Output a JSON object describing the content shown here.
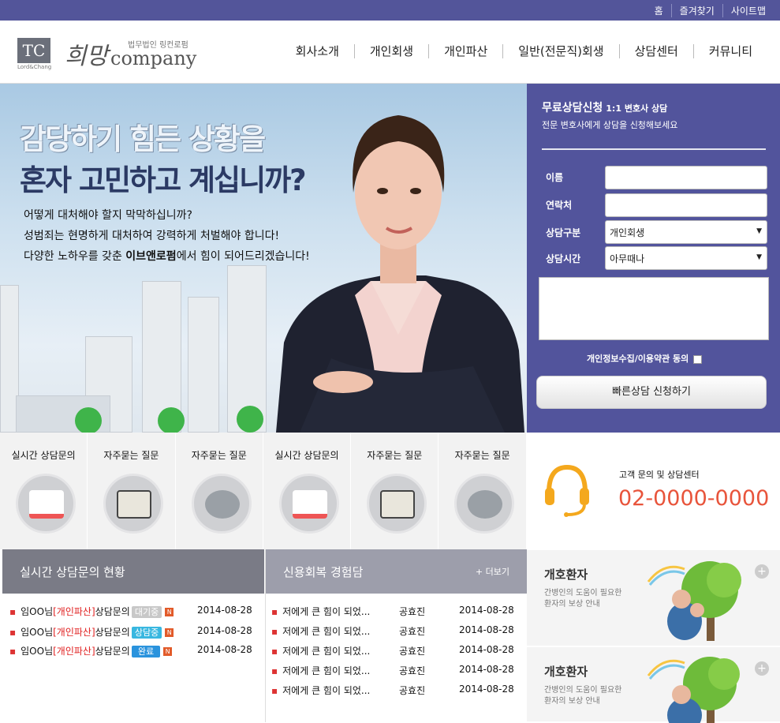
{
  "topbar": {
    "links": [
      "홈",
      "즐겨찾기",
      "사이트맵"
    ]
  },
  "logo": {
    "mark": "TC",
    "mark_caption": "Lord&Chang",
    "script": "희망",
    "sub": "법무법인 링컨로펌",
    "company": "company"
  },
  "nav": [
    "회사소개",
    "개인회생",
    "개인파산",
    "일반(전문직)회생",
    "상담센터",
    "커뮤니티"
  ],
  "hero": {
    "headline1": "감당하기 힘든 상황을",
    "headline2": "혼자 고민하고 계십니까?",
    "line1": "어떻게 대처해야 할지 막막하십니까?",
    "line2": "성범죄는 현명하게 대처하여 강력하게 처벌해야 합니다!",
    "line3_pre": "다양한 노하우를 갖춘 ",
    "line3_bold": "이브앤로펌",
    "line3_post": "에서 힘이 되어드리겠습니다!"
  },
  "form": {
    "title": "무료상담신청",
    "title_small": "1:1 변호사 상담",
    "subtitle": "전문 변호사에게 상담을 신청해보세요",
    "name_label": "이름",
    "phone_label": "연락처",
    "type_label": "상담구분",
    "type_value": "개인회생",
    "time_label": "상담시간",
    "time_value": "아무때나",
    "agree": "개인정보수집/이용약관 동의",
    "submit": "빠른상담 신청하기"
  },
  "quick": [
    {
      "label": "실시간 상담문의",
      "icon": "laptop-icon"
    },
    {
      "label": "자주묻는 질문",
      "icon": "glasses-icon"
    },
    {
      "label": "자주묻는 질문",
      "icon": "globe-dollar-icon"
    },
    {
      "label": "실시간 상담문의",
      "icon": "laptop-icon"
    },
    {
      "label": "자주묻는 질문",
      "icon": "glasses-icon"
    },
    {
      "label": "자주묻는 질문",
      "icon": "globe-dollar-icon"
    }
  ],
  "call": {
    "label": "고객 문의 및 상담센터",
    "phone": "02-0000-0000"
  },
  "consult": {
    "title": "실시간 상담문의 현황",
    "rows": [
      {
        "name": "임OO님",
        "tag": "[개인파산]",
        "text": "상담문의",
        "status": "대기중",
        "status_color": "#c8c8c8",
        "new": "N",
        "date": "2014-08-28"
      },
      {
        "name": "임OO님",
        "tag": "[개인파산]",
        "text": "상담문의",
        "status": "상담중",
        "status_color": "#38b7e0",
        "new": "N",
        "date": "2014-08-28"
      },
      {
        "name": "임OO님",
        "tag": "[개인파산]",
        "text": "상담문의",
        "status": "완료",
        "status_color": "#2a93dd",
        "new": "N",
        "date": "2014-08-28"
      }
    ]
  },
  "reviews": {
    "title": "신용회복 경험담",
    "more": "+ 더보기",
    "rows": [
      {
        "text": "저에게 큰 힘이 되었...",
        "author": "공효진",
        "date": "2014-08-28"
      },
      {
        "text": "저에게 큰 힘이 되었...",
        "author": "공효진",
        "date": "2014-08-28"
      },
      {
        "text": "저에게 큰 힘이 되었...",
        "author": "공효진",
        "date": "2014-08-28"
      },
      {
        "text": "저에게 큰 힘이 되었...",
        "author": "공효진",
        "date": "2014-08-28"
      },
      {
        "text": "저에게 큰 힘이 되었...",
        "author": "공효진",
        "date": "2014-08-28"
      }
    ]
  },
  "side": [
    {
      "title": "개호환자",
      "desc1": "간병인의 도움이 필요한",
      "desc2": "환자의 보상 안내"
    },
    {
      "title": "개호환자",
      "desc1": "간병인의 도움이 필요한",
      "desc2": "환자의 보상 안내"
    }
  ]
}
